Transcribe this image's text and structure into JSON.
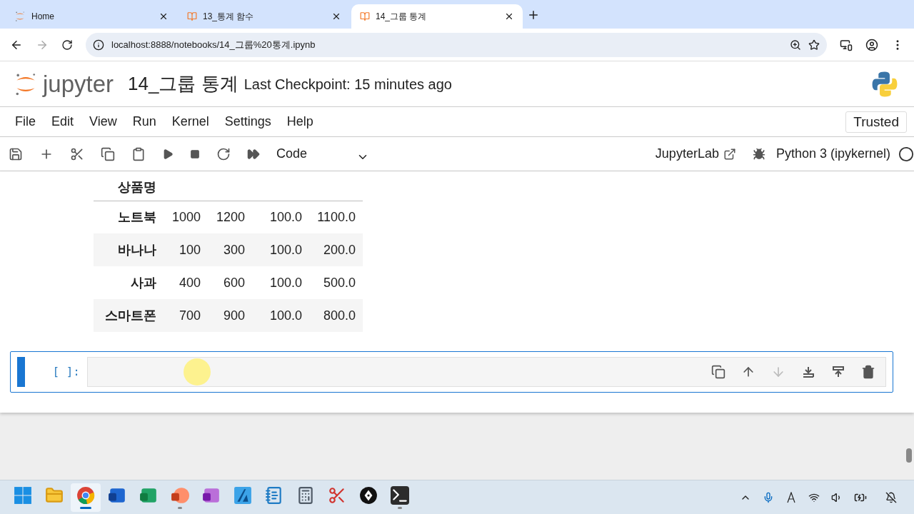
{
  "browser": {
    "tabs": [
      {
        "title": "Home",
        "kind": "jupyter",
        "selected": false
      },
      {
        "title": "13_통계 함수",
        "kind": "notebook",
        "selected": false
      },
      {
        "title": "14_그룹 통계",
        "kind": "notebook",
        "selected": true
      }
    ],
    "url": "localhost:8888/notebooks/14_그룹%20통계.ipynb"
  },
  "header": {
    "logo_text": "jupyter",
    "notebook_title": "14_그룹 통계",
    "checkpoint": "Last Checkpoint: 15 minutes ago"
  },
  "menu": [
    "File",
    "Edit",
    "View",
    "Run",
    "Kernel",
    "Settings",
    "Help"
  ],
  "trusted": "Trusted",
  "toolbar": {
    "cell_type": "Code",
    "lab_link": "JupyterLab",
    "kernel": "Python 3 (ipykernel)"
  },
  "table": {
    "index_name": "상품명",
    "rows": [
      {
        "index": "노트북",
        "cells": [
          "1000",
          "1200",
          "100.0",
          "1100.0"
        ]
      },
      {
        "index": "바나나",
        "cells": [
          "100",
          "300",
          "100.0",
          "200.0"
        ]
      },
      {
        "index": "사과",
        "cells": [
          "400",
          "600",
          "100.0",
          "500.0"
        ]
      },
      {
        "index": "스마트폰",
        "cells": [
          "700",
          "900",
          "100.0",
          "800.0"
        ]
      }
    ]
  },
  "cell": {
    "prompt": "[ ]:",
    "selected": true
  },
  "taskbar": [
    {
      "kind": "start",
      "running": false,
      "selected": false
    },
    {
      "kind": "folder",
      "running": false,
      "selected": false
    },
    {
      "kind": "browser",
      "running": true,
      "selected": true
    },
    {
      "kind": "word",
      "running": false,
      "selected": false
    },
    {
      "kind": "sheet",
      "running": false,
      "selected": false
    },
    {
      "kind": "slides",
      "running": true,
      "selected": false
    },
    {
      "kind": "onenote",
      "running": false,
      "selected": false
    },
    {
      "kind": "vector",
      "running": false,
      "selected": false
    },
    {
      "kind": "notepad",
      "running": false,
      "selected": false
    },
    {
      "kind": "calc",
      "running": false,
      "selected": false
    },
    {
      "kind": "snip",
      "running": false,
      "selected": false
    },
    {
      "kind": "pen",
      "running": false,
      "selected": false
    },
    {
      "kind": "terminal",
      "running": true,
      "selected": false
    }
  ]
}
